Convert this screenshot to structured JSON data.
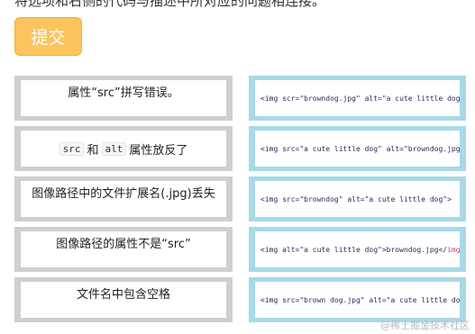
{
  "instruction": "将选项和右侧的代码与描述中所对应的问题相连接。",
  "submit_label": "提交",
  "left_items": [
    {
      "text": "属性“src”拼写错误。"
    },
    {
      "code1": "src",
      "mid": "和",
      "code2": "alt",
      "suffix": "属性放反了"
    },
    {
      "text": "图像路径中的文件扩展名(.jpg)丢失"
    },
    {
      "text": "图像路径的属性不是“src”"
    },
    {
      "text": "文件名中包含空格"
    }
  ],
  "right_items": [
    {
      "code": "<img scr=\"browndog.jpg\" alt=\"a cute little dog\">"
    },
    {
      "code": "<img src=\"a cute little dog\" alt=\"browndog.jpg\">"
    },
    {
      "code": "<img src=\"browndog\" alt=\"a cute little dog\">"
    },
    {
      "code_main": "<img alt=\"a cute little dog\">browndog.jpg</",
      "code_pink": "img",
      "code_end": ">"
    },
    {
      "code": "<img src=\"brown dog.jpg\" alt=\"a cute little dog\">"
    }
  ],
  "watermark": "@稀土掘金技术社区"
}
